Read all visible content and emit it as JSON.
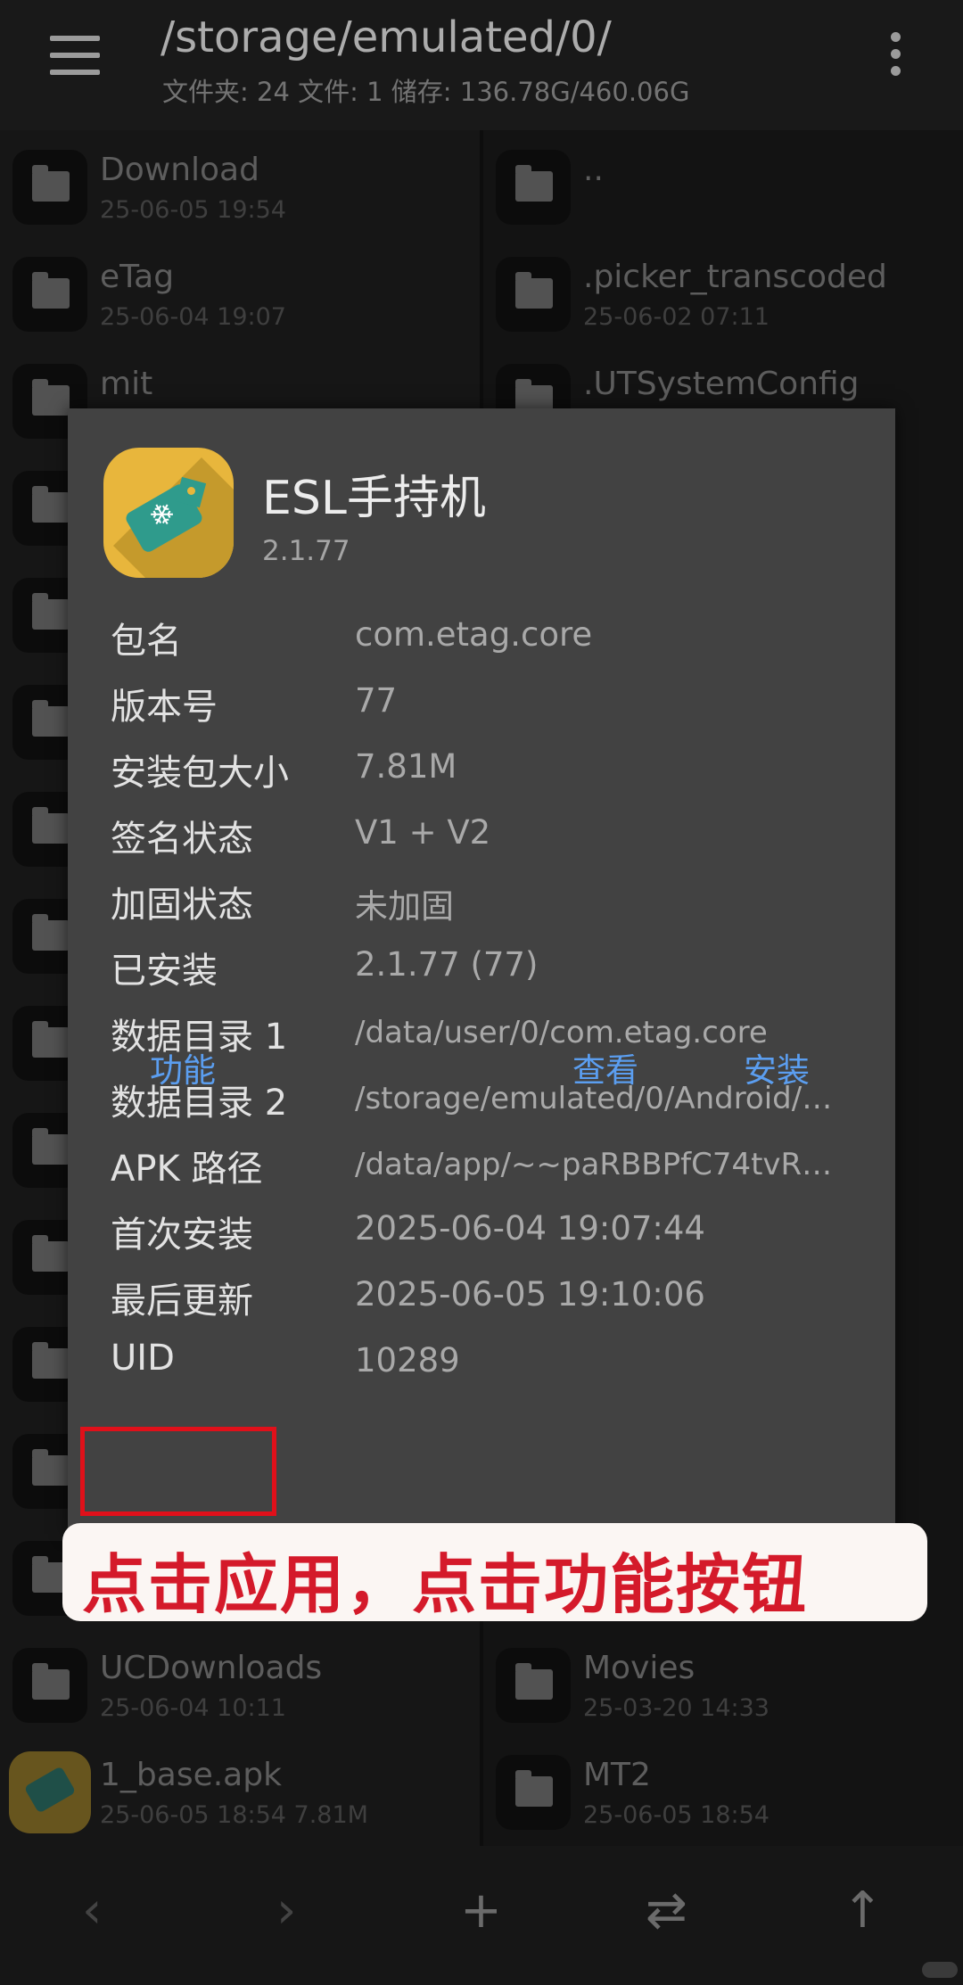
{
  "header": {
    "path": "/storage/emulated/0/",
    "stats": "文件夹: 24  文件: 1  储存: 136.78G/460.06G",
    "menu_icon": "hamburger-menu-icon",
    "more_icon": "kebab-more-icon"
  },
  "left_pane": {
    "items": [
      {
        "name": "Download",
        "date": "25-06-05 19:54"
      },
      {
        "name": "eTag",
        "date": "25-06-04 19:07"
      },
      {
        "name": "mit",
        "date": ""
      },
      {
        "name": "UCDownloads",
        "date": "25-06-04 10:11"
      },
      {
        "name": "1_base.apk",
        "date": "25-06-05 18:54  7.81M"
      }
    ]
  },
  "right_pane": {
    "items": [
      {
        "name": "..",
        "date": ""
      },
      {
        "name": ".picker_transcoded",
        "date": "25-06-02 07:11"
      },
      {
        "name": ".UTSystemConfig",
        "date": ""
      },
      {
        "name": "Movies",
        "date": "25-03-20 14:33"
      },
      {
        "name": "MT2",
        "date": "25-06-05 18:54"
      }
    ]
  },
  "dialog": {
    "app_name": "ESL手持机",
    "version": "2.1.77",
    "rows": [
      {
        "label": "包名",
        "value": "com.etag.core"
      },
      {
        "label": "版本号",
        "value": "77"
      },
      {
        "label": "安装包大小",
        "value": "7.81M"
      },
      {
        "label": "签名状态",
        "value": "V1 + V2"
      },
      {
        "label": "加固状态",
        "value": "未加固"
      },
      {
        "label": "已安装",
        "value": "2.1.77 (77)"
      },
      {
        "label": "数据目录 1",
        "value": "/data/user/0/com.etag.core"
      },
      {
        "label": "数据目录 2",
        "value": "/storage/emulated/0/Android/…"
      },
      {
        "label": "APK 路径",
        "value": "/data/app/~~paRBBPfC74tvR…"
      },
      {
        "label": "首次安装",
        "value": "2025-06-04 19:07:44"
      },
      {
        "label": "最后更新",
        "value": "2025-06-05 19:10:06"
      },
      {
        "label": "UID",
        "value": "10289"
      }
    ],
    "buttons": {
      "function": "功能",
      "view": "查看",
      "install": "安装"
    }
  },
  "annotation": {
    "callout": "点击应用，点击功能按钮",
    "highlight_color": "#e0101a"
  },
  "bottom_bar": {
    "icons": [
      "chevron-left-icon",
      "chevron-right-icon",
      "plus-icon",
      "swap-icon",
      "arrow-up-icon"
    ]
  }
}
